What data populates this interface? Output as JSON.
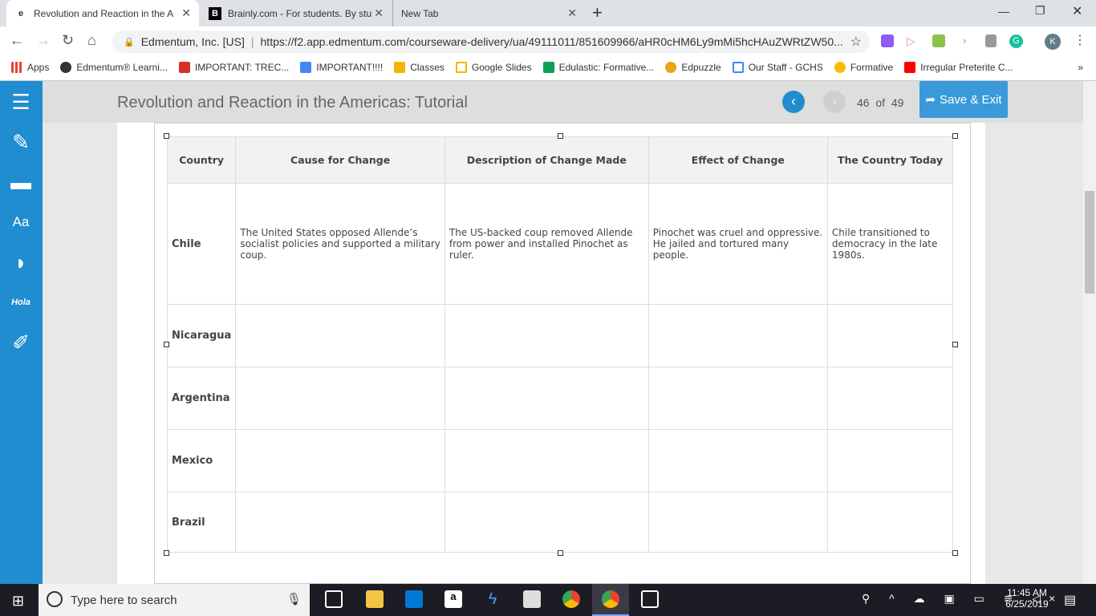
{
  "browser": {
    "tabs": [
      {
        "label": "Revolution and Reaction in the A",
        "active": true
      },
      {
        "label": "Brainly.com - For students. By stu"
      },
      {
        "label": "New Tab"
      }
    ],
    "new_tab": "+",
    "site_identity": "Edmentum, Inc. [US]",
    "url": "https://f2.app.edmentum.com/courseware-delivery/ua/49111011/851609966/aHR0cHM6Ly9mMi5hcHAuZWRtZW50...",
    "profile_initial": "K",
    "bookmarks": [
      "Apps",
      "Edmentum® Learni...",
      "IMPORTANT: TREC...",
      "IMPORTANT!!!!",
      "Classes",
      "Google Slides",
      "Edulastic: Formative...",
      "Edpuzzle",
      "Our Staff - GCHS",
      "Formative",
      "Irregular Preterite C..."
    ],
    "bookmark_colors": [
      "#ea4335",
      "#333",
      "#d93025",
      "#4285f4",
      "#f4b400",
      "#f4b400",
      "#0f9d58",
      "#e8a317",
      "#4285f4",
      "#fbbc05",
      "#ff0000"
    ],
    "more": "»"
  },
  "app": {
    "title": "Revolution and Reaction in the Americas: Tutorial",
    "page_current": "46",
    "page_of": "of",
    "page_total": "49",
    "save_exit": "Save & Exit",
    "accent": "#1f8dd0",
    "sidebar_icons": [
      "list-icon",
      "edit-icon",
      "folder-icon",
      "dictionary-icon",
      "speaker-icon",
      "translate-icon",
      "highlighter-icon"
    ],
    "hola": "Hola",
    "aa": "Aa"
  },
  "table": {
    "headers": [
      "Country",
      "Cause for Change",
      "Description of Change Made",
      "Effect of Change",
      "The Country Today"
    ],
    "rows": [
      [
        "Chile",
        "The United States opposed Allende’s socialist policies and supported a military coup.",
        "The US-backed coup removed Allende from power and installed Pinochet as ruler.",
        "Pinochet was cruel and oppressive. He jailed and tortured many people.",
        "Chile transitioned to democracy in the late 1980s."
      ],
      [
        "Nicaragua",
        "",
        "",
        "",
        ""
      ],
      [
        "Argentina",
        "",
        "",
        "",
        ""
      ],
      [
        "Mexico",
        "",
        "",
        "",
        ""
      ],
      [
        "Brazil",
        "",
        "",
        "",
        ""
      ]
    ]
  },
  "taskbar": {
    "search_placeholder": "Type here to search",
    "time": "11:45 AM",
    "date": "6/25/2019"
  }
}
